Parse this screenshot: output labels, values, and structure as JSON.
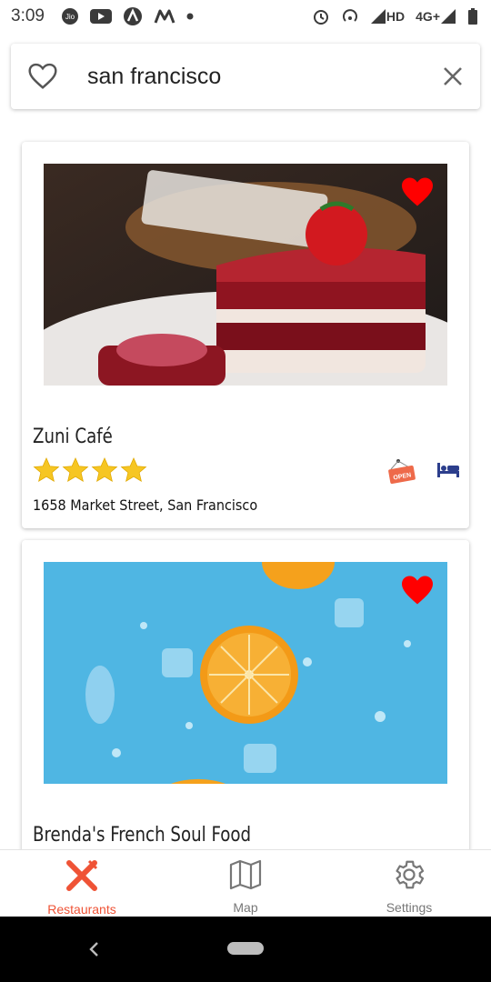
{
  "status_bar": {
    "time": "3:09",
    "network_label": "HD",
    "network_type": "4G+"
  },
  "search": {
    "value": "san francisco",
    "icons": [
      "heart-outline-icon",
      "close-icon"
    ]
  },
  "restaurants": [
    {
      "name": "Zuni Café",
      "rating": 4,
      "rating_max": 4,
      "address": "1658 Market Street, San Francisco",
      "favorite": true,
      "badges": [
        "open-sign-icon",
        "bed-icon"
      ],
      "open_label": "OPEN"
    },
    {
      "name": "Brenda's French Soul Food",
      "favorite": true
    }
  ],
  "bottom_nav": {
    "items": [
      {
        "label": "Restaurants",
        "icon": "fork-knife-icon",
        "active": true
      },
      {
        "label": "Map",
        "icon": "map-icon",
        "active": false
      },
      {
        "label": "Settings",
        "icon": "gear-icon",
        "active": false
      }
    ]
  },
  "colors": {
    "accent": "#ef5336",
    "heart": "#ff0000",
    "star": "#f6c623",
    "bed": "#2c3e8c"
  }
}
